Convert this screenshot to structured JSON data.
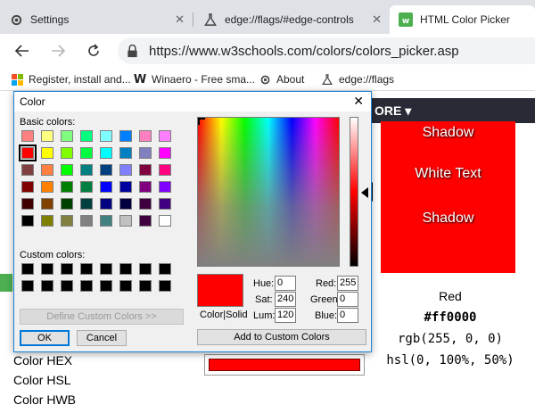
{
  "browser": {
    "tabs": [
      {
        "title": "Settings",
        "icon": "gear-icon"
      },
      {
        "title": "edge://flags/#edge-controls",
        "icon": "flask-icon"
      },
      {
        "title": "HTML Color Picker",
        "icon": "w3schools-icon"
      }
    ],
    "url": "https://www.w3schools.com/colors/colors_picker.asp",
    "bookmarks": [
      {
        "label": "Register, install and...",
        "icon": "windows-icon"
      },
      {
        "label": "Winaero - Free sma...",
        "icon": "winaero-icon"
      },
      {
        "label": "About",
        "icon": "gear-icon"
      },
      {
        "label": "edge://flags",
        "icon": "flask-icon"
      }
    ]
  },
  "page": {
    "nav_more": "ORE ▾",
    "preview_text": [
      "Shadow",
      "White Text",
      "Shadow"
    ],
    "color_name": "Red",
    "color_hex": "#ff0000",
    "color_rgb": "rgb(255, 0, 0)",
    "color_hsl": "hsl(0, 100%, 50%)",
    "side_links": [
      "Color HEX",
      "Color HSL",
      "Color HWB"
    ]
  },
  "dialog": {
    "title": "Color",
    "basic_colors_label": "Basic colors:",
    "custom_colors_label": "Custom colors:",
    "define_custom_button": "Define Custom Colors >>",
    "ok_button": "OK",
    "cancel_button": "Cancel",
    "add_custom_button": "Add to Custom Colors",
    "color_solid_label": "Color|Solid",
    "fields": {
      "hue": {
        "label": "Hue:",
        "value": "0"
      },
      "sat": {
        "label": "Sat:",
        "value": "240"
      },
      "lum": {
        "label": "Lum:",
        "value": "120"
      },
      "red": {
        "label": "Red:",
        "value": "255"
      },
      "green": {
        "label": "Green:",
        "value": "0"
      },
      "blue": {
        "label": "Blue:",
        "value": "0"
      }
    },
    "basic_colors": [
      "#ff8080",
      "#ffff80",
      "#80ff80",
      "#00ff80",
      "#80ffff",
      "#0080ff",
      "#ff80c0",
      "#ff80ff",
      "#ff0000",
      "#ffff00",
      "#80ff00",
      "#00ff40",
      "#00ffff",
      "#0080c0",
      "#8080c0",
      "#ff00ff",
      "#804040",
      "#ff8040",
      "#00ff00",
      "#008080",
      "#004080",
      "#8080ff",
      "#800040",
      "#ff0080",
      "#800000",
      "#ff8000",
      "#008000",
      "#008040",
      "#0000ff",
      "#0000a0",
      "#800080",
      "#8000ff",
      "#400000",
      "#804000",
      "#004000",
      "#004040",
      "#000080",
      "#000040",
      "#400040",
      "#400080",
      "#000000",
      "#808000",
      "#808040",
      "#808080",
      "#408080",
      "#c0c0c0",
      "#400040",
      "#ffffff"
    ],
    "selected_index": 8
  }
}
